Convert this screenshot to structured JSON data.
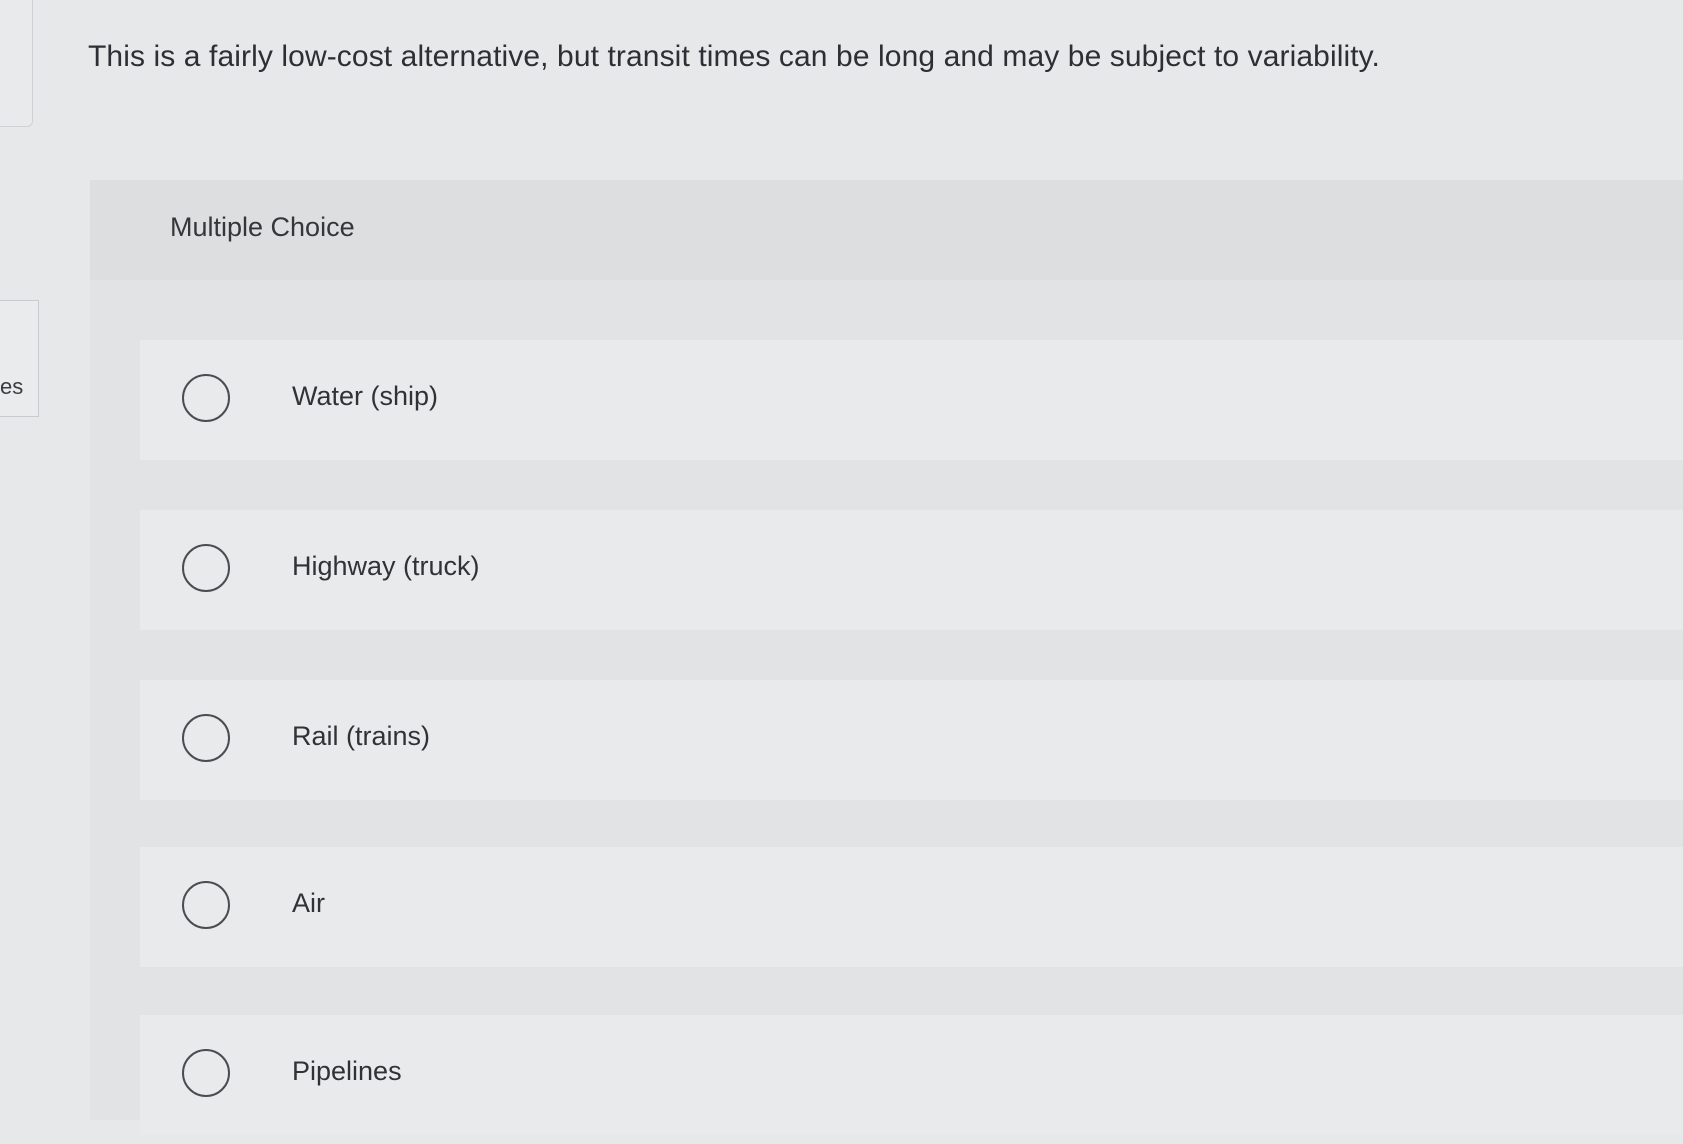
{
  "sidebar": {
    "partial_label": "es"
  },
  "question": {
    "text": "This is a fairly low-cost alternative, but transit times can be long and may be subject to variability."
  },
  "multiple_choice": {
    "heading": "Multiple Choice",
    "options": [
      {
        "label": "Water (ship)",
        "selected": false
      },
      {
        "label": "Highway (truck)",
        "selected": false
      },
      {
        "label": "Rail (trains)",
        "selected": false
      },
      {
        "label": "Air",
        "selected": false
      },
      {
        "label": "Pipelines",
        "selected": false
      }
    ]
  }
}
